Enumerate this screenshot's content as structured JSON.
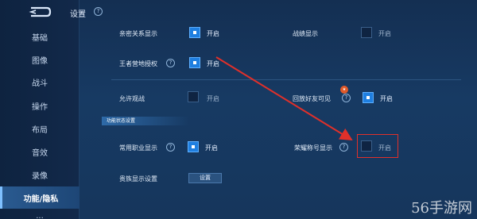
{
  "header": {
    "title": "设置"
  },
  "sidebar": {
    "items": [
      {
        "label": "基础"
      },
      {
        "label": "图像"
      },
      {
        "label": "战斗"
      },
      {
        "label": "操作"
      },
      {
        "label": "布局"
      },
      {
        "label": "音效"
      },
      {
        "label": "录像"
      },
      {
        "label": "功能/隐私"
      },
      {
        "label": "..."
      }
    ]
  },
  "settings": {
    "intimate": {
      "label": "亲密关系显示",
      "toggle": "开启",
      "checked": true
    },
    "record": {
      "label": "战绩显示",
      "toggle": "开启",
      "checked": false
    },
    "camp": {
      "label": "王者营地授权",
      "toggle": "开启",
      "checked": true
    },
    "spectate": {
      "label": "允许观战",
      "toggle": "开启",
      "checked": false
    },
    "replay": {
      "label": "回放好友可见",
      "toggle": "开启",
      "checked": true
    },
    "section": {
      "title": "功能状态设置"
    },
    "job": {
      "label": "常用职业显示",
      "toggle": "开启",
      "checked": true
    },
    "honor": {
      "label": "荣耀称号显示",
      "toggle": "开启",
      "checked": false
    },
    "noble": {
      "label": "贵族显示设置",
      "button": "设置"
    }
  },
  "watermark": {
    "text": "56手游网"
  },
  "colors": {
    "accent": "#1f7fe0",
    "highlight": "#e0302a"
  }
}
